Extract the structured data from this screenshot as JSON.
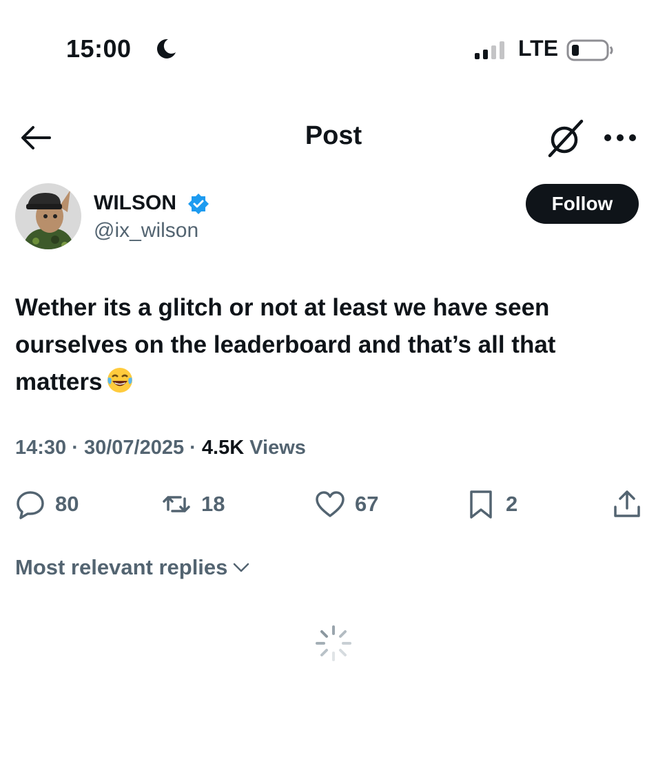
{
  "status_bar": {
    "time": "15:00",
    "network": "LTE",
    "icons": [
      "moon-icon",
      "signal-icon",
      "battery-icon"
    ]
  },
  "header": {
    "title": "Post",
    "icons": [
      "back-arrow-icon",
      "grok-icon",
      "more-icon"
    ]
  },
  "author": {
    "name": "WILSON",
    "handle": "@ix_wilson",
    "verified": true,
    "follow_label": "Follow"
  },
  "post": {
    "text": "Wether its a glitch or not at least we have seen ourselves on the leaderboard and that’s all that matters",
    "emoji": "face-with-tears-of-joy",
    "time": "14:30",
    "date": "30/07/2025",
    "views_count": "4.5K",
    "views_label": "Views"
  },
  "actions": {
    "replies": "80",
    "reposts": "18",
    "likes": "67",
    "bookmarks": "2"
  },
  "replies_sort": {
    "label": "Most relevant replies"
  },
  "colors": {
    "text": "#0f1419",
    "secondary": "#536471",
    "verified": "#1d9bf0",
    "button_bg": "#0f1419"
  }
}
